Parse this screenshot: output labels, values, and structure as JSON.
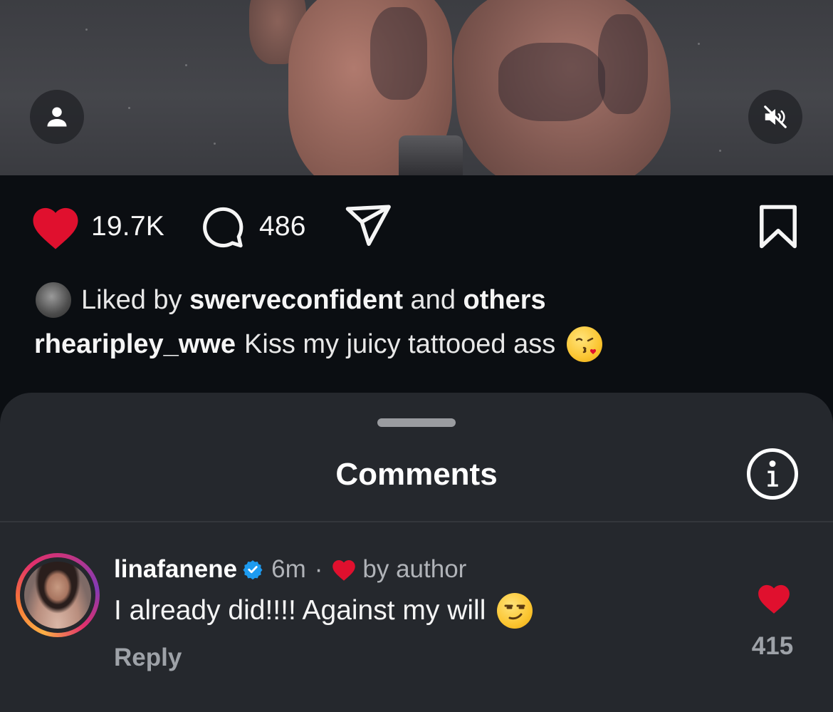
{
  "post": {
    "like_count": "19.7K",
    "comment_count": "486",
    "liked_by_prefix": "Liked by",
    "liked_by_user": "swerveconfident",
    "liked_by_joiner": "and",
    "liked_by_suffix": "others",
    "caption_user": "rhearipley_wwe",
    "caption_text": "Kiss my juicy tattooed ass",
    "caption_emoji": "😘"
  },
  "icons": {
    "profile": "person-icon",
    "mute": "speaker-muted-icon",
    "like": "heart-filled-icon",
    "comment": "speech-bubble-icon",
    "share": "paper-plane-icon",
    "save": "bookmark-icon",
    "info": "info-icon",
    "verified": "verified-badge-icon"
  },
  "colors": {
    "like_red": "#e0102e",
    "verified_blue": "#1d9bf0",
    "sheet_bg": "#25282d",
    "page_bg": "#0b0e12",
    "muted_text": "#b0b3b8"
  },
  "comments_sheet": {
    "title": "Comments",
    "comments": [
      {
        "username": "linafanene",
        "verified": true,
        "time": "6m",
        "separator": "·",
        "liked_by_author_label": "by author",
        "text": "I already did!!!! Against my will",
        "emoji": "😏",
        "reply_label": "Reply",
        "like_count": "415"
      }
    ]
  }
}
